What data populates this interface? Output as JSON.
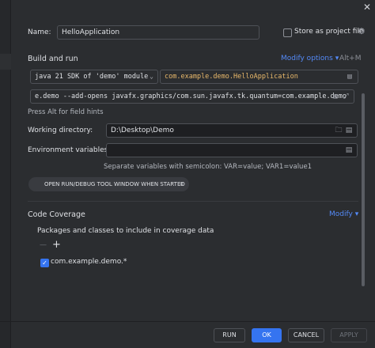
{
  "window": {
    "close_glyph": "✕"
  },
  "name": {
    "label": "Name:",
    "value": "HelloApplication",
    "store_label": "Store as project file",
    "store_checked": false,
    "gear_glyph": "⚙"
  },
  "build": {
    "title": "Build and run",
    "modify_options": "Modify options",
    "modify_options_arrow": "▾",
    "shortcut": "Alt+M",
    "jdk": "java 21 SDK of 'demo' module",
    "jdk_arrow": "⌄",
    "main_class": "com.example.demo.HelloApplication",
    "vm_options": "e.demo --add-opens javafx.graphics/com.sun.javafx.tk.quantum=com.example.demo",
    "field_hint": "Press Alt for field hints",
    "list_glyph": "▤",
    "expand_glyph": "⤢"
  },
  "working_dir": {
    "label": "Working directory:",
    "value": "D:\\Desktop\\Demo",
    "folder_glyph": "🗀",
    "list_glyph": "▤"
  },
  "env": {
    "label": "Environment variables:",
    "value": "",
    "list_glyph": "▤",
    "hint": "Separate variables with semicolon: VAR=value; VAR1=value1"
  },
  "chip": {
    "label": "OPEN RUN/DEBUG TOOL WINDOW WHEN STARTED",
    "close": "×"
  },
  "coverage": {
    "title": "Code Coverage",
    "modify": "Modify",
    "modify_arrow": "▾",
    "packages_label": "Packages and classes to include in coverage data",
    "remove_glyph": "—",
    "add_glyph": "+",
    "items": [
      {
        "label": "com.example.demo.*",
        "checked": true
      }
    ]
  },
  "footer": {
    "run": "RUN",
    "ok": "OK",
    "cancel": "CANCEL",
    "apply": "APPLY"
  },
  "colors": {
    "background": "#2b2d30",
    "accent": "#3574f0",
    "link": "#548af7",
    "text": "#dfe1e5"
  }
}
